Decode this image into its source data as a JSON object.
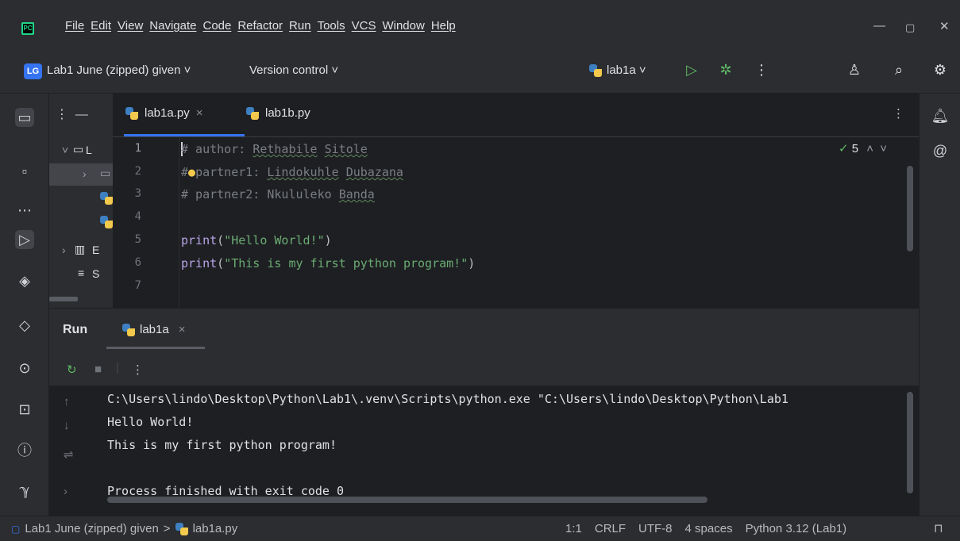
{
  "menubar": {
    "items": [
      "File",
      "Edit",
      "View",
      "Navigate",
      "Code",
      "Refactor",
      "Run",
      "Tools",
      "VCS",
      "Window",
      "Help"
    ],
    "logo": "PC"
  },
  "toolbar": {
    "project_badge": "LG",
    "project_name": "Lab1 June (zipped) given ˅",
    "version_control": "Version control ˅",
    "run_config": "lab1a ˅"
  },
  "tabs": [
    {
      "label": "lab1a.py",
      "close": "×"
    },
    {
      "label": "lab1b.py"
    }
  ],
  "project_panel": {
    "rows": [
      "L",
      "E",
      "S"
    ]
  },
  "editor": {
    "line_numbers": [
      "1",
      "2",
      "3",
      "4",
      "5",
      "6",
      "7"
    ],
    "inspection_count": "5",
    "lines": {
      "l1_prefix": "# author: ",
      "l1_a": "Rethabile",
      "l1_b": "Sitole",
      "l2_prefix": "#",
      "l2_mid": "partner1: ",
      "l2_a": "Lindokuhle",
      "l2_b": "Dubazana",
      "l3_prefix": "# partner2: Nkululeko ",
      "l3_a": "Banda",
      "l5_fn": "print",
      "l5_open": "(",
      "l5_str": "\"Hello World!\"",
      "l5_close": ")",
      "l6_fn": "print",
      "l6_open": "(",
      "l6_str": "\"This is my first python program!\"",
      "l6_close": ")"
    }
  },
  "run_panel": {
    "title": "Run",
    "tab_label": "lab1a",
    "tab_close": "×",
    "console_lines": [
      "C:\\Users\\lindo\\Desktop\\Python\\Lab1\\.venv\\Scripts\\python.exe \"C:\\Users\\lindo\\Desktop\\Python\\Lab1",
      "Hello World!",
      "This is my first python program!",
      "",
      "Process finished with exit code 0"
    ]
  },
  "statusbar": {
    "project": "Lab1 June (zipped) given",
    "sep": ">",
    "file": "lab1a.py",
    "position": "1:1",
    "line_sep": "CRLF",
    "encoding": "UTF-8",
    "indent": "4 spaces",
    "interpreter": "Python 3.12 (Lab1)"
  },
  "colors": {
    "accent": "#3574f0",
    "background": "#1e1f22",
    "panel": "#2b2d30",
    "string": "#6aab73",
    "run_green": "#5fb865"
  }
}
